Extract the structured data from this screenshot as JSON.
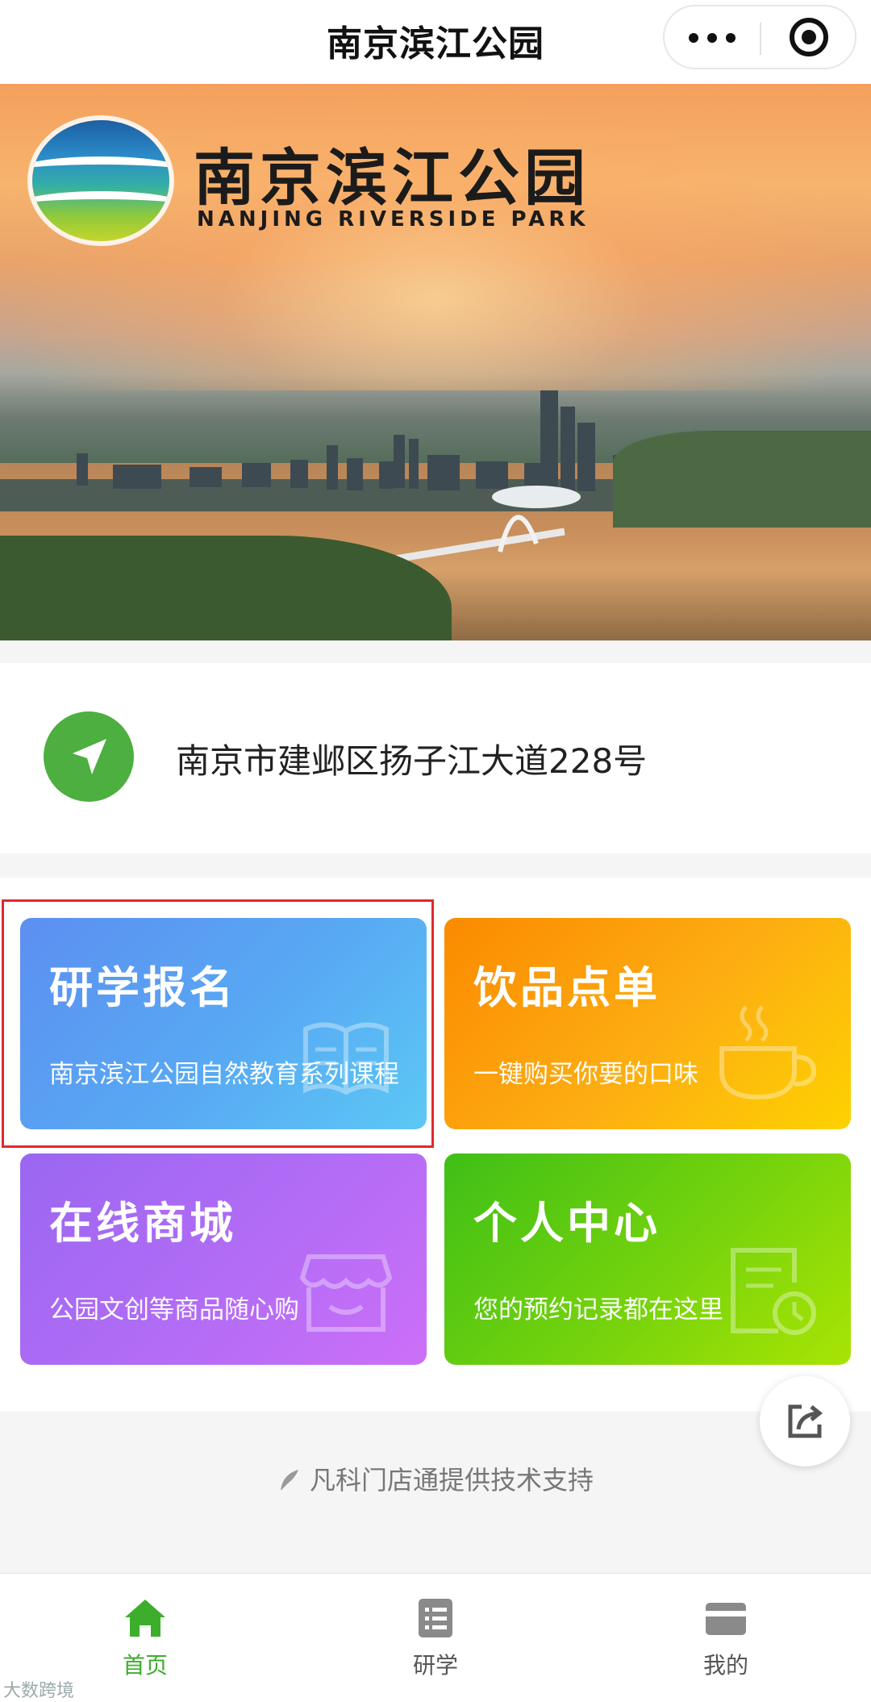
{
  "header": {
    "title": "南京滨江公园"
  },
  "banner": {
    "logo_cn": "南京滨江公园",
    "logo_en": "NANJING RIVERSIDE PARK"
  },
  "address": {
    "text": "南京市建邺区扬子江大道228号",
    "icon": "navigation-arrow-icon"
  },
  "cards": [
    {
      "title": "研学报名",
      "subtitle": "南京滨江公园自然教育系列课程",
      "icon": "book-icon",
      "highlighted": true
    },
    {
      "title": "饮品点单",
      "subtitle": "一键购买你要的口味",
      "icon": "coffee-cup-icon",
      "highlighted": false
    },
    {
      "title": "在线商城",
      "subtitle": "公园文创等商品随心购",
      "icon": "shop-icon",
      "highlighted": false
    },
    {
      "title": "个人中心",
      "subtitle": "您的预约记录都在这里",
      "icon": "record-clock-icon",
      "highlighted": false
    }
  ],
  "footer": {
    "support": "凡科门店通提供技术支持"
  },
  "tabbar": {
    "items": [
      {
        "label": "首页",
        "icon": "home-icon",
        "active": true
      },
      {
        "label": "研学",
        "icon": "list-icon",
        "active": false
      },
      {
        "label": "我的",
        "icon": "card-icon",
        "active": false
      }
    ]
  },
  "watermark": "大数跨境",
  "colors": {
    "accent_green": "#3dae2b",
    "highlight_red": "#e0292d",
    "card_blue": "#58a9f3",
    "card_orange": "#fdae12",
    "card_purple": "#b36cf6",
    "card_green": "#76d30c"
  }
}
